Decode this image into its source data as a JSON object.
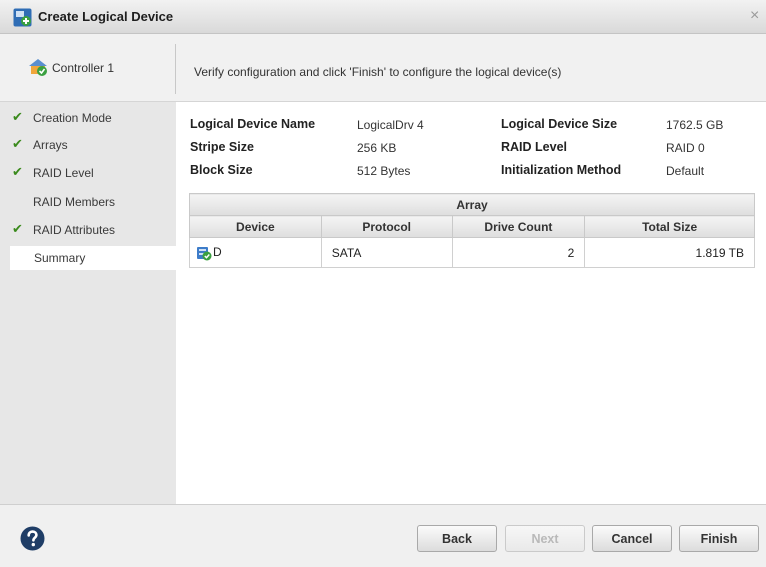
{
  "window": {
    "title": "Create Logical Device",
    "close_glyph": "×"
  },
  "sidebar": {
    "controller_label": "Controller 1",
    "steps": [
      {
        "label": "Creation Mode",
        "done": true
      },
      {
        "label": "Arrays",
        "done": true
      },
      {
        "label": "RAID Level",
        "done": true
      },
      {
        "label": "RAID Members",
        "done": false
      },
      {
        "label": "RAID Attributes",
        "done": true
      },
      {
        "label": "Summary",
        "done": false,
        "current": true
      }
    ],
    "check_glyph": "✔"
  },
  "banner": {
    "text": "Verify configuration and click 'Finish' to configure the logical device(s)"
  },
  "summary": {
    "logical_device_name_label": "Logical Device Name",
    "logical_device_name_value": "LogicalDrv 4",
    "stripe_size_label": "Stripe Size",
    "stripe_size_value": "256 KB",
    "block_size_label": "Block Size",
    "block_size_value": "512 Bytes",
    "logical_device_size_label": "Logical Device Size",
    "logical_device_size_value": "1762.5 GB",
    "raid_level_label": "RAID Level",
    "raid_level_value": "RAID 0",
    "init_method_label": "Initialization Method",
    "init_method_value": "Default"
  },
  "array_table": {
    "group_header": "Array",
    "columns": [
      "Device",
      "Protocol",
      "Drive Count",
      "Total Size"
    ],
    "rows": [
      {
        "device": "D",
        "protocol": "SATA",
        "drive_count": "2",
        "total_size": "1.819 TB"
      }
    ]
  },
  "footer": {
    "back_label": "Back",
    "next_label": "Next",
    "cancel_label": "Cancel",
    "finish_label": "Finish"
  },
  "colors": {
    "check": "#3a8a1c",
    "help": "#1f3d66"
  },
  "icons": {
    "app": "add-logical-device-icon",
    "controller": "controller-icon",
    "device": "array-device-icon",
    "help": "help-icon"
  }
}
